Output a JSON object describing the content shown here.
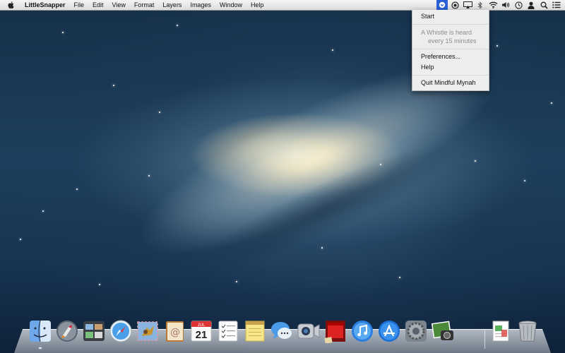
{
  "menubar": {
    "app_name": "LittleSnapper",
    "menus": [
      "File",
      "Edit",
      "View",
      "Format",
      "Layers",
      "Images",
      "Window",
      "Help"
    ],
    "status_icons": [
      "mynah-menu-icon",
      "time-machine-icon",
      "airplay-icon",
      "bluetooth-icon",
      "wifi-icon",
      "volume-icon",
      "clock-icon",
      "user-icon",
      "spotlight-icon",
      "notification-center-icon"
    ]
  },
  "dropdown": {
    "start": "Start",
    "status_line1": "A Whistle is heard",
    "status_line2": "every 15 minutes",
    "preferences": "Preferences...",
    "help": "Help",
    "quit": "Quit Mindful Mynah"
  },
  "dock": {
    "calendar_month": "JUL",
    "calendar_day": "21",
    "apps": [
      "finder",
      "launchpad",
      "mission-control",
      "safari",
      "mail",
      "contacts",
      "calendar",
      "reminders",
      "notes",
      "messages",
      "facetime",
      "photo-booth",
      "itunes",
      "app-store",
      "system-preferences",
      "iphoto",
      "documents",
      "trash"
    ]
  },
  "colors": {
    "menu_highlight": "#2a5fd6",
    "menubar_bg": "#e8e8e8"
  }
}
